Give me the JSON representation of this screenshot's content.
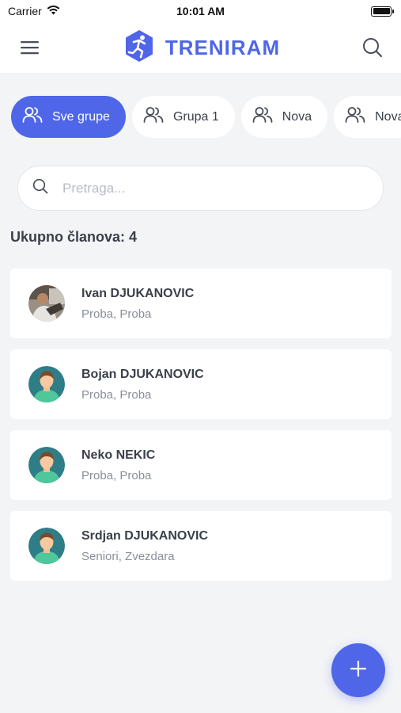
{
  "status_bar": {
    "carrier": "Carrier",
    "time": "10:01 AM"
  },
  "header": {
    "app_name": "TRENIRAM",
    "brand_color": "#4f66e8"
  },
  "groups": [
    {
      "label": "Sve grupe",
      "active": true
    },
    {
      "label": "Grupa 1",
      "active": false
    },
    {
      "label": "Nova",
      "active": false
    },
    {
      "label": "Nova",
      "active": false
    }
  ],
  "search": {
    "placeholder": "Pretraga...",
    "value": ""
  },
  "summary": {
    "total_label": "Ukupno članova: 4"
  },
  "members": [
    {
      "name": "Ivan DJUKANOVIC",
      "groups": "Proba, Proba",
      "avatar": "photo-avatar"
    },
    {
      "name": "Bojan DJUKANOVIC",
      "groups": "Proba, Proba",
      "avatar": "default-avatar"
    },
    {
      "name": "Neko NEKIC",
      "groups": "Proba, Proba",
      "avatar": "default-avatar"
    },
    {
      "name": "Srdjan DJUKANOVIC",
      "groups": "Seniori, Zvezdara",
      "avatar": "default-avatar"
    }
  ],
  "icons": {
    "menu": "hamburger-menu-icon",
    "search": "search-icon",
    "group": "users-icon",
    "add": "plus-icon",
    "logo": "runner-logo-icon"
  }
}
